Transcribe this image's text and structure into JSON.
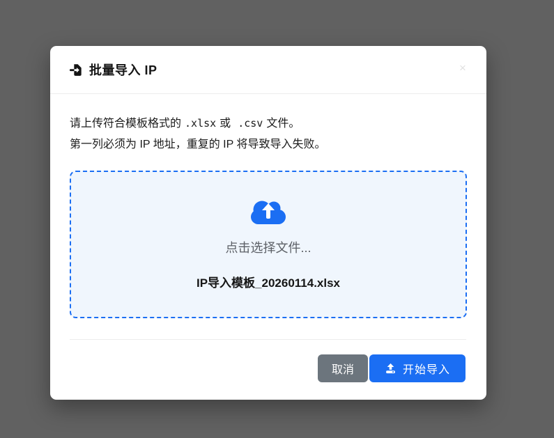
{
  "window": {
    "backdrop_color": "#616161"
  },
  "modal": {
    "header": {
      "title": "批量导入 IP",
      "icon": "file-import-icon",
      "close_glyph": "×"
    },
    "instructions": {
      "line1": {
        "prefix": "请上传符合模板格式的",
        "ext1": ".xlsx",
        "conjunction": "或",
        "ext2": ".csv",
        "suffix": "文件。"
      },
      "line2": "第一列必须为 IP 地址，重复的 IP 将导致导入失败。"
    },
    "dropzone": {
      "icon": "cloud-upload-icon",
      "prompt": "点击选择文件...",
      "template_filename": "IP导入模板_20260114.xlsx"
    },
    "footer": {
      "cancel_label": "取消",
      "start_import_label": "开始导入",
      "start_import_icon": "upload-icon"
    },
    "colors": {
      "accent_blue": "#1b6ef3",
      "secondary_gray": "#6c757d",
      "dropzone_bg": "#f0f6fd",
      "divider": "#ececec"
    }
  }
}
